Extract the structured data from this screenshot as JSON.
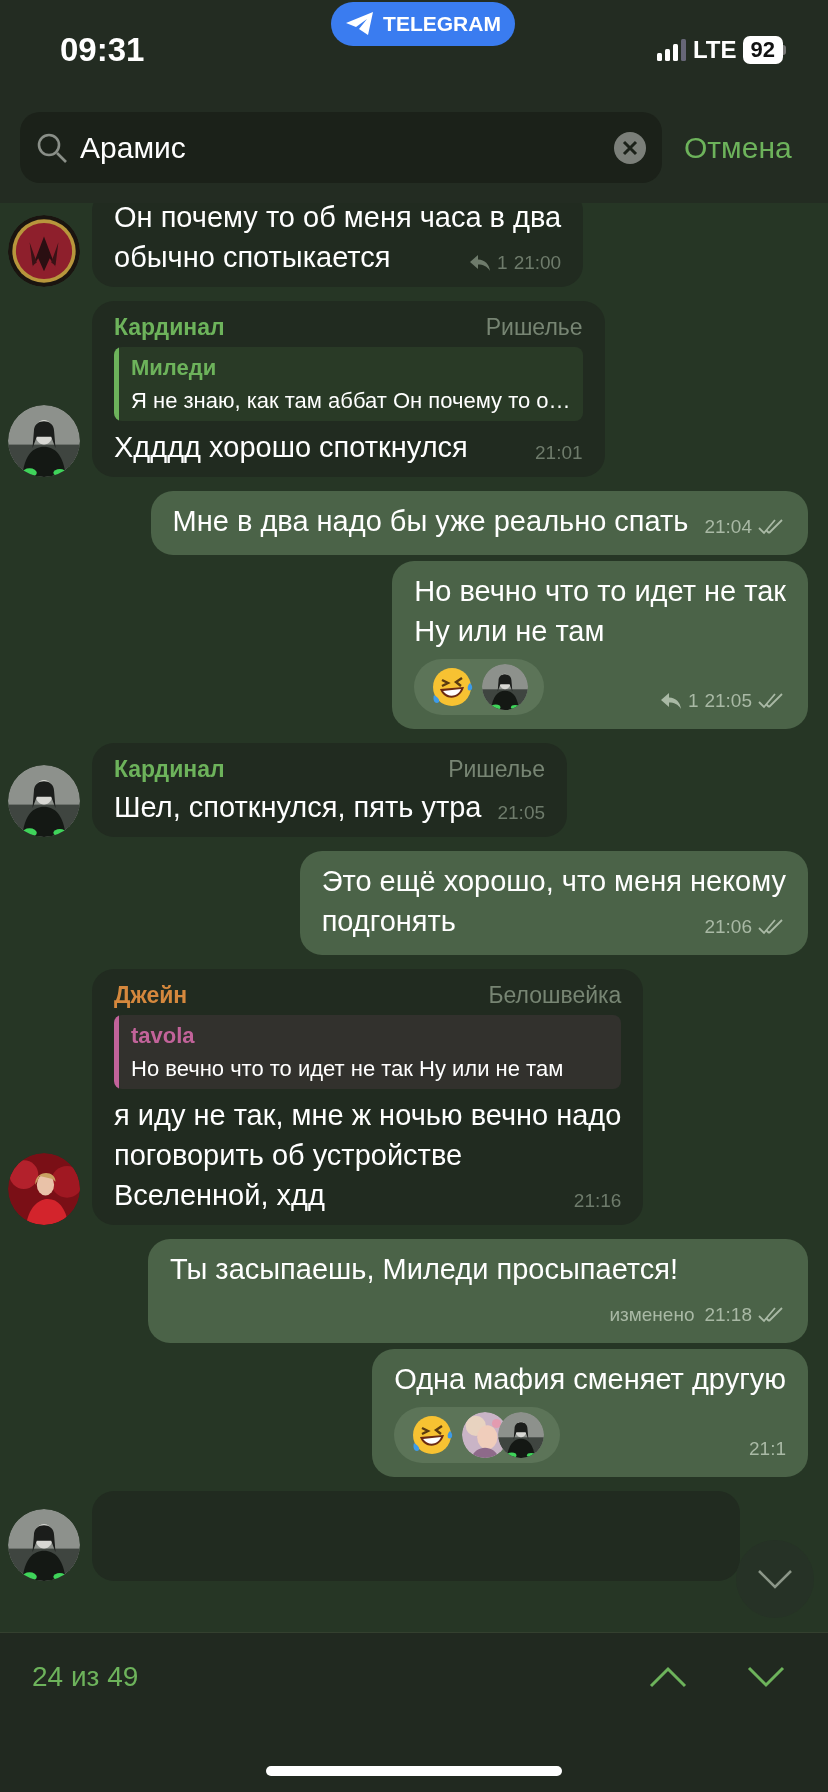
{
  "status_bar": {
    "time": "09:31",
    "app": "TELEGRAM",
    "network": "LTE",
    "battery": "92"
  },
  "search": {
    "value": "Арамис",
    "cancel": "Отмена"
  },
  "messages": [
    {
      "kind": "incoming",
      "lines": [
        "Он почему то об меня часа в два",
        "обычно спотыкается"
      ],
      "replies": "1",
      "time": "21:00"
    },
    {
      "kind": "incoming",
      "sender": {
        "name": "Кардинал",
        "color": "#6db35b"
      },
      "title": "Ришелье",
      "quote": {
        "author": "Миледи",
        "text": "Я не знаю, как там аббат Он почему то о…",
        "color": "#6db35b"
      },
      "lines": [
        "Хдддд хорошо споткнулся"
      ],
      "time": "21:01"
    },
    {
      "kind": "outgoing",
      "lines": [
        "Мне в два надо бы уже реально спать"
      ],
      "time": "21:04",
      "read": true
    },
    {
      "kind": "outgoing",
      "lines": [
        "Но вечно что то идет не так",
        "Ну или не там"
      ],
      "reactions": [
        {
          "kind": "laugh"
        }
      ],
      "replies": "1",
      "time": "21:05",
      "read": true
    },
    {
      "kind": "incoming",
      "sender": {
        "name": "Кардинал",
        "color": "#6db35b"
      },
      "title": "Ришелье",
      "lines": [
        "Шел, споткнулся, пять утра"
      ],
      "time": "21:05"
    },
    {
      "kind": "outgoing",
      "lines": [
        "Это ещё хорошо, что меня некому",
        "подгонять"
      ],
      "time": "21:06",
      "read": true
    },
    {
      "kind": "incoming",
      "sender": {
        "name": "Джейн",
        "color": "#d5883d"
      },
      "title": "Белошвейка",
      "quote": {
        "author": "tavola",
        "text": "Но вечно что то идет не так Ну или не там",
        "color": "#c2639a"
      },
      "lines": [
        "я иду не так, мне ж ночью вечно надо",
        "поговорить об устройстве",
        "Вселенной, хдд"
      ],
      "time": "21:16"
    },
    {
      "kind": "outgoing",
      "lines": [
        "Ты засыпаешь, Миледи просыпается!"
      ],
      "edited": "изменено",
      "time": "21:18",
      "read": true
    },
    {
      "kind": "outgoing",
      "lines": [
        "Одна мафия сменяет другую"
      ],
      "reactions": [
        {
          "kind": "laugh"
        }
      ],
      "time": "21:1"
    },
    {
      "kind": "incoming"
    }
  ],
  "footer": {
    "counter": "24 из 49"
  }
}
